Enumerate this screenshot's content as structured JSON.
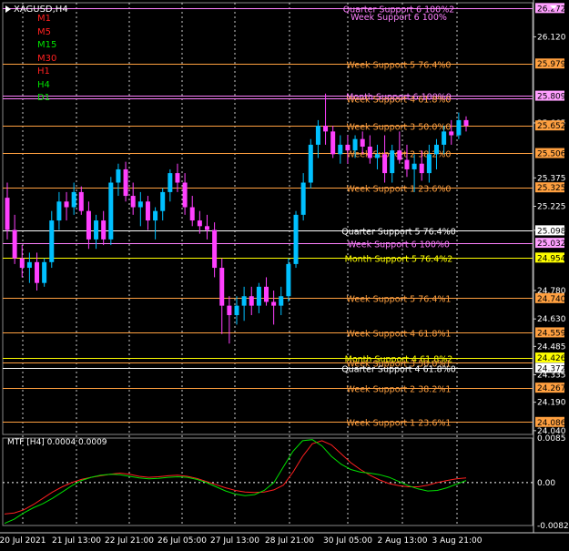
{
  "symbol": "XAGUSD,H4",
  "indicator_label": "MTF [H4] 0.0004 0.0009",
  "timeframes": [
    {
      "label": "M1",
      "color": "#ff2020"
    },
    {
      "label": "M5",
      "color": "#ff2020"
    },
    {
      "label": "M15",
      "color": "#00e000"
    },
    {
      "label": "M30",
      "color": "#ff2020"
    },
    {
      "label": "H1",
      "color": "#ff2020"
    },
    {
      "label": "H4",
      "color": "#00e000"
    },
    {
      "label": "D1",
      "color": "#00e000"
    }
  ],
  "price_axis": {
    "ticks": [
      "26.120",
      "25.665",
      "25.375",
      "25.225",
      "25.098",
      "24.780",
      "24.630",
      "24.485",
      "24.335",
      "24.190",
      "24.040"
    ],
    "range": [
      24.02,
      26.3
    ]
  },
  "highlight_labels": [
    {
      "price": 26.272,
      "text": "26.272",
      "bg": "#ffa0ff"
    },
    {
      "price": 25.979,
      "text": "25.979",
      "bg": "#ffa040"
    },
    {
      "price": 25.809,
      "text": "25.809",
      "bg": "#ffa0ff"
    },
    {
      "price": 25.652,
      "text": "25.652",
      "bg": "#ffa040"
    },
    {
      "price": 25.506,
      "text": "25.506",
      "bg": "#ffa040"
    },
    {
      "price": 25.325,
      "text": "25.325",
      "bg": "#ffa040"
    },
    {
      "price": 25.098,
      "text": "25.098",
      "bg": "#ffffff"
    },
    {
      "price": 25.032,
      "text": "25.032",
      "bg": "#ffa0ff"
    },
    {
      "price": 24.954,
      "text": "24.954",
      "bg": "#ffff00"
    },
    {
      "price": 24.74,
      "text": "24.740",
      "bg": "#ffa040"
    },
    {
      "price": 24.559,
      "text": "24.559",
      "bg": "#ffa040"
    },
    {
      "price": 24.426,
      "text": "24.426",
      "bg": "#ffff00"
    },
    {
      "price": 24.372,
      "text": "24.372",
      "bg": "#ffffff"
    },
    {
      "price": 24.267,
      "text": "24.267",
      "bg": "#ffa040"
    },
    {
      "price": 24.086,
      "text": "24.086",
      "bg": "#ffa040"
    }
  ],
  "levels": [
    {
      "price": 26.272,
      "color": "#ff80ff",
      "text": "Quarter Support 6 100%2",
      "text_color": "#ff80ff"
    },
    {
      "price": 26.272,
      "color": "#ff80ff",
      "text": "Week Support 6 100%"
    },
    {
      "price": 25.979,
      "color": "#ffa040",
      "text": "Week Support 5 76.4%0",
      "text_color": "#ffa040"
    },
    {
      "price": 25.809,
      "color": "#ff80ff",
      "text": "Month Support 6 100%0",
      "text_color": "#ff80ff"
    },
    {
      "price": 25.795,
      "color": "#ff80ff",
      "text": "Week Support 4 61.8%0",
      "text_color": "#ffa040"
    },
    {
      "price": 25.652,
      "color": "#ffa040",
      "text": "Week Support 3 50.0%0",
      "text_color": "#ffa040"
    },
    {
      "price": 25.506,
      "color": "#ffa040",
      "text": "Week Support 2 38.2%0",
      "text_color": "#ffa040"
    },
    {
      "price": 25.325,
      "color": "#ffa040",
      "text": "Week Support 1 23.6%0",
      "text_color": "#ffa040"
    },
    {
      "price": 25.098,
      "color": "#ffffff",
      "text": "Quarter Support 5 76.4%0",
      "text_color": "#ffffff"
    },
    {
      "price": 25.032,
      "color": "#ff80ff",
      "text": "Week Support 6 100%0",
      "text_color": "#ff80ff"
    },
    {
      "price": 24.954,
      "color": "#ffff00",
      "text": "Month Support 5 76.4%2",
      "text_color": "#ffff00"
    },
    {
      "price": 24.74,
      "color": "#ffa040",
      "text": "Week Support 5 76.4%1",
      "text_color": "#ffa040"
    },
    {
      "price": 24.559,
      "color": "#ffa040",
      "text": "Week Support 4 61.8%1",
      "text_color": "#ffa040"
    },
    {
      "price": 24.426,
      "color": "#ffff00",
      "text": "Month Support 4 61.8%2",
      "text_color": "#ffff00"
    },
    {
      "price": 24.4,
      "color": "#ffa040",
      "text": "Week Support 3 50.0%1",
      "text_color": "#ffa040"
    },
    {
      "price": 24.372,
      "color": "#ffffff",
      "text": "Quarter Support 4 61.8%0",
      "text_color": "#ffffff"
    },
    {
      "price": 24.267,
      "color": "#ffa040",
      "text": "Week Support 2 38.2%1",
      "text_color": "#ffa040"
    },
    {
      "price": 24.086,
      "color": "#ffa040",
      "text": "Week Support 1 23.6%1",
      "text_color": "#ffa040"
    }
  ],
  "time_axis": [
    "20 Jul 2021",
    "21 Jul 13:00",
    "22 Jul 21:00",
    "26 Jul 05:00",
    "27 Jul 13:00",
    "28 Jul 21:00",
    "30 Jul 05:00",
    "2 Aug 13:00",
    "3 Aug 21:00"
  ],
  "indicator_axis": [
    "0.0085",
    "0.00",
    "-0.0082"
  ],
  "colors": {
    "bull": "#00c0ff",
    "bear": "#ff40ff",
    "grid": "#ffffff",
    "osc_green": "#00e000",
    "osc_red": "#ff2020"
  },
  "chart_data": {
    "type": "candlestick",
    "symbol": "XAGUSD",
    "timeframe": "H4",
    "ylim": [
      24.02,
      26.3
    ],
    "candles": [
      [
        25.27,
        25.35,
        25.05,
        25.1
      ],
      [
        25.1,
        25.18,
        24.92,
        24.95
      ],
      [
        24.95,
        25.02,
        24.85,
        24.9
      ],
      [
        24.9,
        24.98,
        24.82,
        24.93
      ],
      [
        24.93,
        24.98,
        24.78,
        24.82
      ],
      [
        24.82,
        24.95,
        24.8,
        24.93
      ],
      [
        24.93,
        25.2,
        24.9,
        25.15
      ],
      [
        25.15,
        25.3,
        25.1,
        25.25
      ],
      [
        25.25,
        25.3,
        25.15,
        25.22
      ],
      [
        25.22,
        25.35,
        25.18,
        25.3
      ],
      [
        25.3,
        25.33,
        25.18,
        25.2
      ],
      [
        25.2,
        25.25,
        25.0,
        25.05
      ],
      [
        25.05,
        25.18,
        25.0,
        25.15
      ],
      [
        25.15,
        25.2,
        25.02,
        25.05
      ],
      [
        25.05,
        25.38,
        25.02,
        25.35
      ],
      [
        25.35,
        25.45,
        25.28,
        25.42
      ],
      [
        25.42,
        25.46,
        25.25,
        25.28
      ],
      [
        25.28,
        25.35,
        25.18,
        25.22
      ],
      [
        25.22,
        25.3,
        25.12,
        25.25
      ],
      [
        25.25,
        25.28,
        25.1,
        25.15
      ],
      [
        25.15,
        25.22,
        25.05,
        25.2
      ],
      [
        25.2,
        25.32,
        25.15,
        25.3
      ],
      [
        25.3,
        25.42,
        25.25,
        25.4
      ],
      [
        25.4,
        25.45,
        25.3,
        25.35
      ],
      [
        25.35,
        25.4,
        25.18,
        25.22
      ],
      [
        25.22,
        25.28,
        25.12,
        25.15
      ],
      [
        25.15,
        25.2,
        25.08,
        25.12
      ],
      [
        25.12,
        25.18,
        25.05,
        25.1
      ],
      [
        25.1,
        25.14,
        24.85,
        24.9
      ],
      [
        24.9,
        24.95,
        24.55,
        24.7
      ],
      [
        24.7,
        24.75,
        24.5,
        24.65
      ],
      [
        24.65,
        24.75,
        24.6,
        24.7
      ],
      [
        24.7,
        24.8,
        24.62,
        24.75
      ],
      [
        24.75,
        24.8,
        24.65,
        24.7
      ],
      [
        24.7,
        24.82,
        24.66,
        24.8
      ],
      [
        24.8,
        24.85,
        24.7,
        24.72
      ],
      [
        24.72,
        24.78,
        24.6,
        24.7
      ],
      [
        24.7,
        24.8,
        24.65,
        24.75
      ],
      [
        24.75,
        24.95,
        24.72,
        24.92
      ],
      [
        24.92,
        25.2,
        24.9,
        25.18
      ],
      [
        25.18,
        25.4,
        25.15,
        25.35
      ],
      [
        25.35,
        25.58,
        25.32,
        25.55
      ],
      [
        25.55,
        25.68,
        25.48,
        25.65
      ],
      [
        25.65,
        25.82,
        25.55,
        25.62
      ],
      [
        25.62,
        25.65,
        25.48,
        25.5
      ],
      [
        25.5,
        25.6,
        25.45,
        25.55
      ],
      [
        25.55,
        25.6,
        25.45,
        25.52
      ],
      [
        25.52,
        25.6,
        25.48,
        25.58
      ],
      [
        25.58,
        25.62,
        25.5,
        25.54
      ],
      [
        25.54,
        25.6,
        25.45,
        25.48
      ],
      [
        25.48,
        25.55,
        25.42,
        25.5
      ],
      [
        25.5,
        25.6,
        25.35,
        25.4
      ],
      [
        25.4,
        25.55,
        25.35,
        25.52
      ],
      [
        25.52,
        25.62,
        25.45,
        25.47
      ],
      [
        25.47,
        25.55,
        25.38,
        25.42
      ],
      [
        25.42,
        25.5,
        25.3,
        25.45
      ],
      [
        25.45,
        25.52,
        25.36,
        25.4
      ],
      [
        25.4,
        25.55,
        25.35,
        25.5
      ],
      [
        25.5,
        25.58,
        25.42,
        25.55
      ],
      [
        25.55,
        25.65,
        25.5,
        25.62
      ],
      [
        25.62,
        25.68,
        25.55,
        25.6
      ],
      [
        25.6,
        25.72,
        25.58,
        25.68
      ],
      [
        25.68,
        25.7,
        25.62,
        25.65
      ]
    ],
    "oscillator": {
      "name": "MTF [H4]",
      "values_shown": [
        0.0004,
        0.0009
      ],
      "ylim": [
        -0.0082,
        0.0085
      ],
      "green": [
        -0.0078,
        -0.007,
        -0.0058,
        -0.0048,
        -0.004,
        -0.003,
        -0.0018,
        -0.0006,
        0.0004,
        0.001,
        0.0014,
        0.0016,
        0.0015,
        0.0012,
        0.0009,
        0.0007,
        0.0008,
        0.001,
        0.0011,
        0.001,
        0.0006,
        0.0,
        -0.0008,
        -0.0016,
        -0.0022,
        -0.0025,
        -0.0023,
        -0.0015,
        0.0,
        0.003,
        0.006,
        0.008,
        0.0082,
        0.007,
        0.005,
        0.0035,
        0.0025,
        0.002,
        0.0018,
        0.0015,
        0.001,
        0.0002,
        -0.0006,
        -0.0012,
        -0.0016,
        -0.0015,
        -0.001,
        -0.0003,
        0.0004
      ],
      "red": [
        -0.006,
        -0.0058,
        -0.0052,
        -0.0042,
        -0.003,
        -0.0018,
        -0.0008,
        0.0,
        0.0006,
        0.001,
        0.0013,
        0.0016,
        0.0018,
        0.0016,
        0.0012,
        0.001,
        0.0011,
        0.0013,
        0.0014,
        0.0012,
        0.0008,
        0.0002,
        -0.0004,
        -0.001,
        -0.0015,
        -0.0018,
        -0.0019,
        -0.0018,
        -0.0014,
        -0.0005,
        0.002,
        0.005,
        0.0074,
        0.008,
        0.0072,
        0.0055,
        0.0038,
        0.0025,
        0.0014,
        0.0005,
        -0.0002,
        -0.0006,
        -0.0008,
        -0.0008,
        -0.0005,
        0.0,
        0.0004,
        0.0007,
        0.0009
      ]
    }
  }
}
